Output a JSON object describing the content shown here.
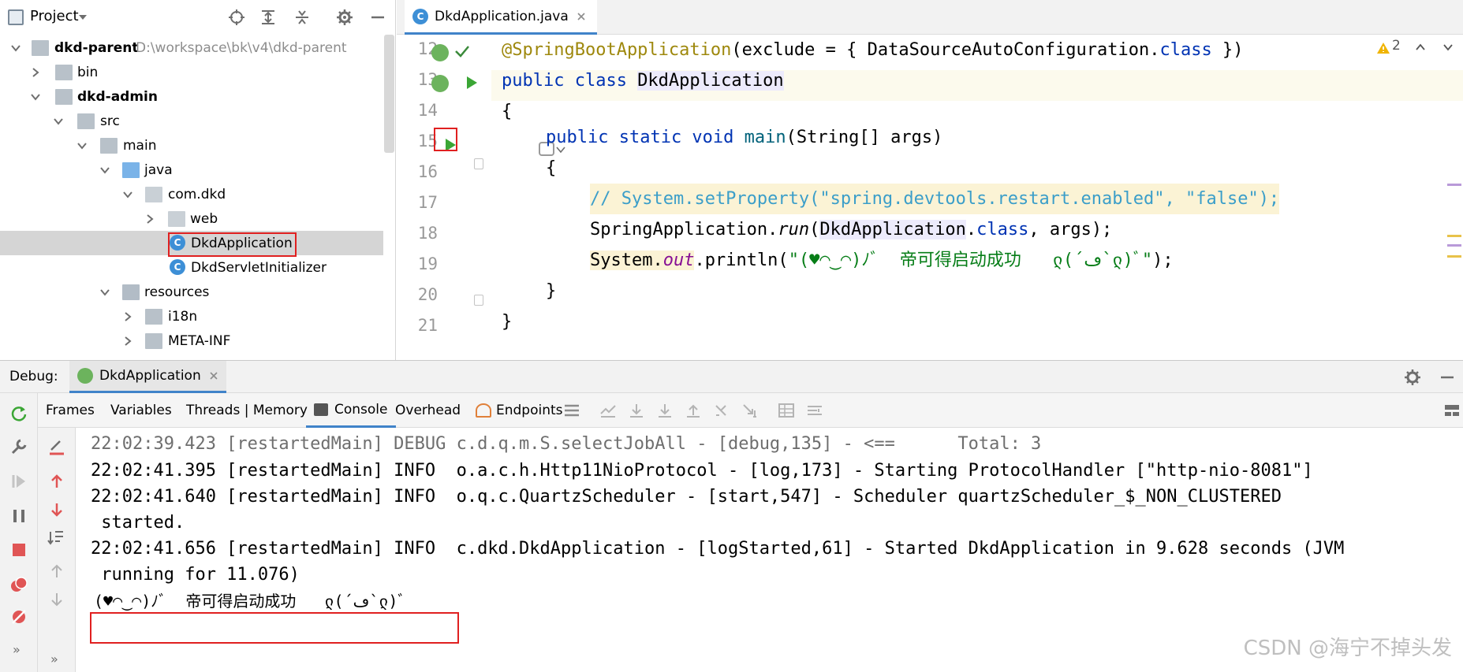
{
  "project_panel": {
    "title": "Project",
    "tree": [
      {
        "label": "dkd-parent",
        "hint": "D:\\workspace\\bk\\v4\\dkd-parent",
        "bold": true,
        "expanded": true,
        "icon": "module-folder-icon"
      },
      {
        "label": "bin",
        "expanded": false,
        "icon": "folder-icon"
      },
      {
        "label": "dkd-admin",
        "bold": true,
        "expanded": true,
        "icon": "module-folder-icon"
      },
      {
        "label": "src",
        "expanded": true,
        "icon": "folder-icon"
      },
      {
        "label": "main",
        "expanded": true,
        "icon": "folder-icon"
      },
      {
        "label": "java",
        "expanded": true,
        "icon": "source-folder-icon"
      },
      {
        "label": "com.dkd",
        "expanded": true,
        "icon": "package-icon"
      },
      {
        "label": "web",
        "expanded": false,
        "icon": "package-icon"
      },
      {
        "label": "DkdApplication",
        "selected": true,
        "icon": "spring-class-icon"
      },
      {
        "label": "DkdServletInitializer",
        "icon": "class-icon"
      },
      {
        "label": "resources",
        "expanded": true,
        "icon": "resources-folder-icon"
      },
      {
        "label": "i18n",
        "expanded": false,
        "icon": "folder-icon"
      },
      {
        "label": "META-INF",
        "expanded": false,
        "icon": "folder-icon"
      }
    ]
  },
  "editor": {
    "tab_label": "DkdApplication.java",
    "warnings_count": "2",
    "line_numbers": [
      "12",
      "13",
      "14",
      "15",
      "16",
      "17",
      "18",
      "19",
      "20",
      "21"
    ],
    "code": {
      "l12_ann": "@SpringBootApplication",
      "l12_rest_a": "(exclude = { DataSourceAutoConfiguration.",
      "l12_kw": "class",
      "l12_rest_b": " })",
      "l13_kw": "public class ",
      "l13_name": "DkdApplication",
      "l14": "{",
      "l15_kw": "public static void ",
      "l15_m": "main",
      "l15_rest": "(String[] args)",
      "l16": "{",
      "l17": "// System.setProperty(\"spring.devtools.restart.enabled\", \"false\");",
      "l18_a": "SpringApplication.",
      "l18_run": "run",
      "l18_b": "(",
      "l18_cls": "DkdApplication",
      "l18_c": ".",
      "l18_kw": "class",
      "l18_d": ", args);",
      "l19_a": "System.",
      "l19_out": "out",
      "l19_b": ".println(",
      "l19_str": "\"(♥◠‿◠)ﾉﾞ  帝可得启动成功   ლ(´ڡ`ლ)ﾞ\"",
      "l19_c": ");",
      "l20": "}",
      "l21": "}"
    }
  },
  "debug": {
    "label": "Debug:",
    "session_tab": "DkdApplication",
    "tabs": {
      "frames": "Frames",
      "variables": "Variables",
      "threads": "Threads | Memory",
      "console": "Console",
      "overhead": "Overhead",
      "endpoints": "Endpoints"
    },
    "console_lines": [
      "22:02:39.423 [restartedMain] DEBUG c.d.q.m.S.selectJobAll - [debug,135] - <==      Total: 3",
      "22:02:41.395 [restartedMain] INFO  o.a.c.h.Http11NioProtocol - [log,173] - Starting ProtocolHandler [\"http-nio-8081\"]",
      "22:02:41.640 [restartedMain] INFO  o.q.c.QuartzScheduler - [start,547] - Scheduler quartzScheduler_$_NON_CLUSTERED",
      " started.",
      "22:02:41.656 [restartedMain] INFO  c.dkd.DkdApplication - [logStarted,61] - Started DkdApplication in 9.628 seconds (JVM",
      " running for 11.076)",
      "(♥◠‿◠)ﾉﾞ  帝可得启动成功   ლ(´ڡ`ლ)ﾞ"
    ]
  },
  "watermark": "CSDN @海宁不掉头发",
  "colors": {
    "accent": "#4083c9",
    "highlight_box": "#e02020",
    "run_green": "#3ba635"
  }
}
